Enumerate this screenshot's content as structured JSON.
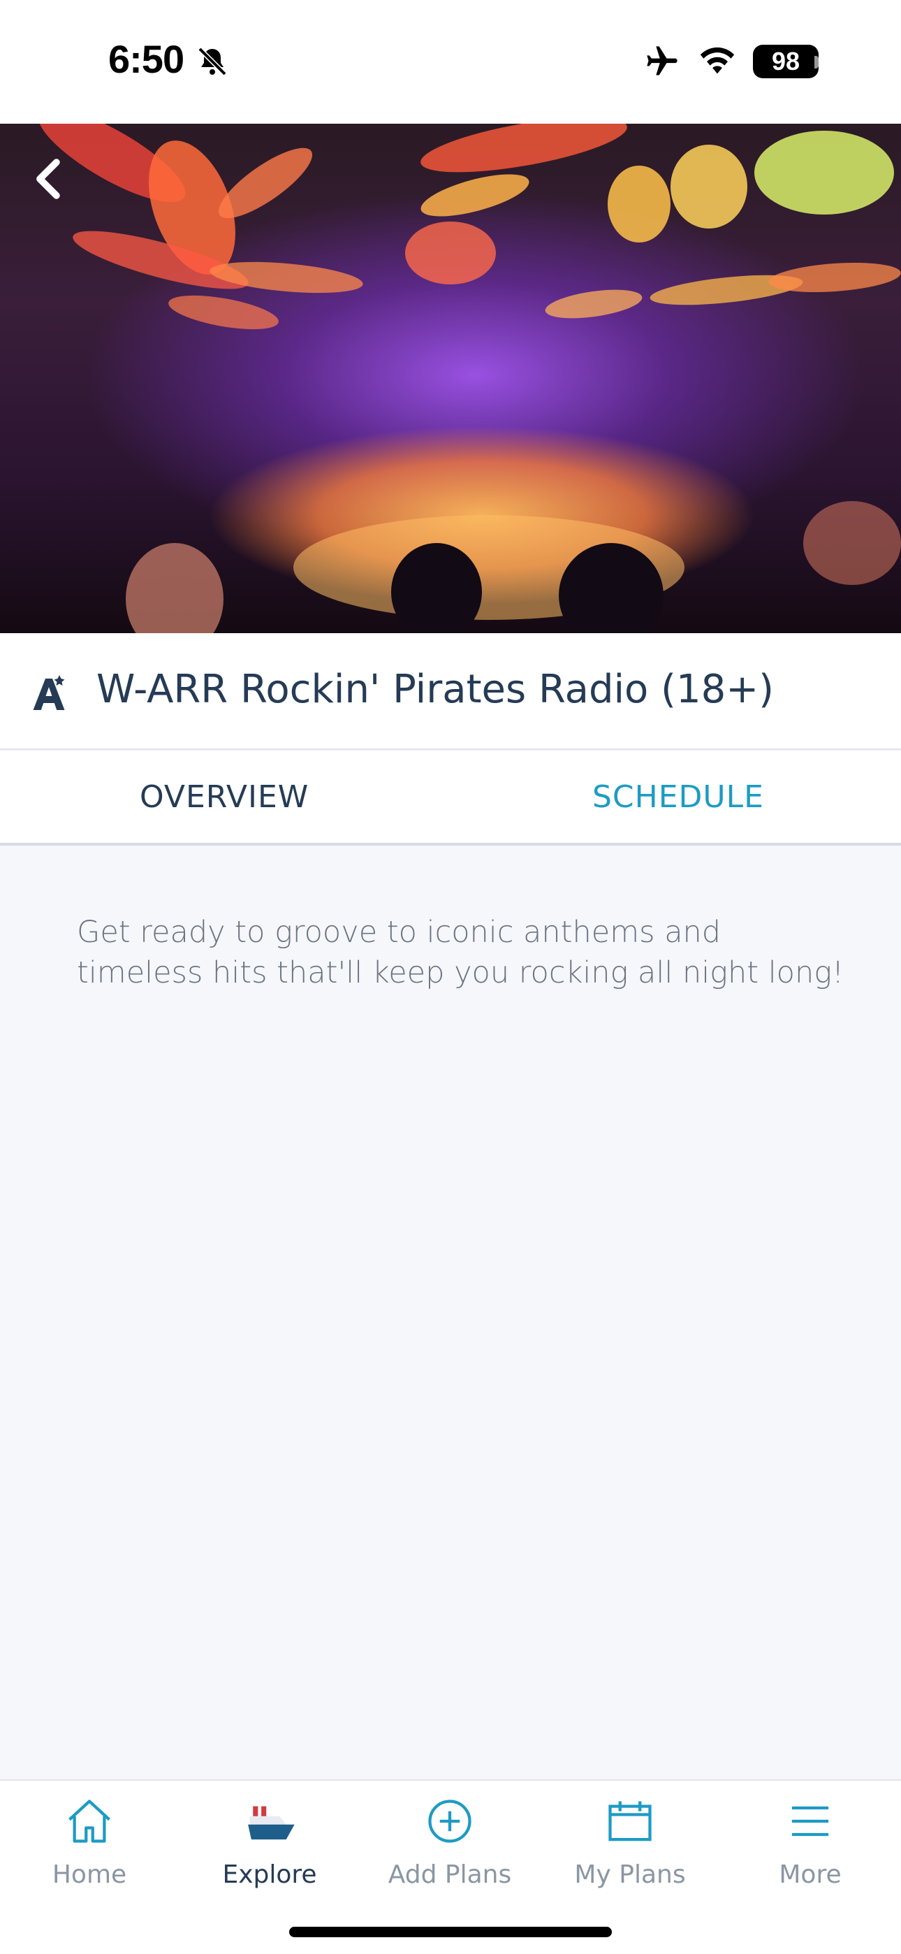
{
  "status_bar": {
    "time": "6:50",
    "battery": "98",
    "icons": [
      "bell-slash-icon",
      "airplane-icon",
      "wifi-icon",
      "battery-icon"
    ]
  },
  "hero": {
    "back_icon": "chevron-left-icon"
  },
  "activity": {
    "icon": "adult-activity-icon",
    "title": "W-ARR Rockin' Pirates Radio (18+)"
  },
  "tabs": [
    {
      "label": "OVERVIEW",
      "selected": true
    },
    {
      "label": "SCHEDULE",
      "selected": false
    }
  ],
  "overview": {
    "description": "Get ready to groove to iconic anthems and timeless hits that'll keep you rocking all night long!"
  },
  "bottom_nav": {
    "items": [
      {
        "label": "Home",
        "icon": "home-icon",
        "active": false
      },
      {
        "label": "Explore",
        "icon": "ship-icon",
        "active": true
      },
      {
        "label": "Add Plans",
        "icon": "plus-circle-icon",
        "active": false
      },
      {
        "label": "My Plans",
        "icon": "calendar-icon",
        "active": false
      },
      {
        "label": "More",
        "icon": "menu-icon",
        "active": false
      }
    ]
  },
  "colors": {
    "primary_text": "#253b56",
    "accent": "#1d9bc4",
    "muted": "#8a96a3",
    "background": "#f6f7fb",
    "ship_red": "#d23a3e",
    "ship_blue": "#1d5f8a"
  }
}
